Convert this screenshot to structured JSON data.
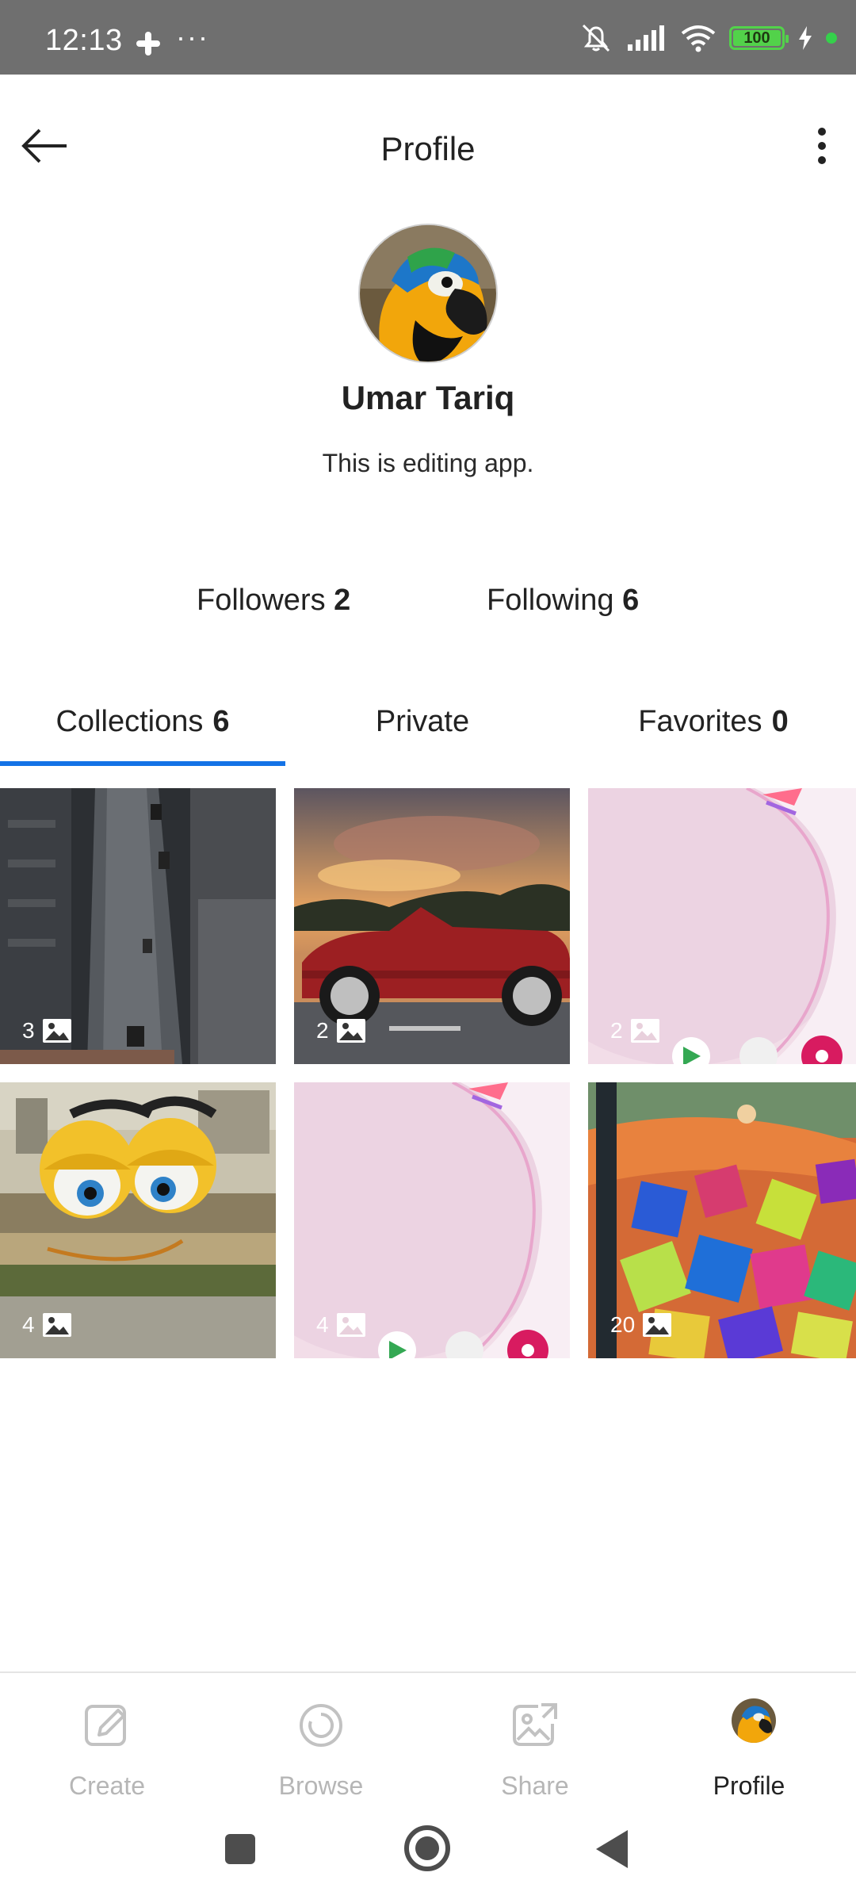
{
  "status_bar": {
    "time": "12:13",
    "dots": "···",
    "battery": "100",
    "icons": [
      "slack-icon",
      "mute-icon",
      "signal-icon",
      "wifi-icon",
      "battery-icon",
      "charging-icon"
    ]
  },
  "app_bar": {
    "title": "Profile",
    "back_icon": "arrow-left-icon",
    "menu_icon": "more-vertical-icon"
  },
  "profile": {
    "name": "Umar Tariq",
    "bio": "This is editing app.",
    "avatar": "parrot-avatar"
  },
  "stats": {
    "followers_label": "Followers",
    "followers_count": "2",
    "following_label": "Following",
    "following_count": "6"
  },
  "tabs": [
    {
      "label": "Collections",
      "count": "6",
      "active": true
    },
    {
      "label": "Private",
      "count": "",
      "active": false
    },
    {
      "label": "Favorites",
      "count": "0",
      "active": false
    }
  ],
  "collections": [
    {
      "count": "3",
      "thumb": "rainy-city-street"
    },
    {
      "count": "2",
      "thumb": "red-convertible-sunset"
    },
    {
      "count": "2",
      "thumb": "pink-wallpaper-screenshot"
    },
    {
      "count": "4",
      "thumb": "cartoon-eyes-rooftop"
    },
    {
      "count": "4",
      "thumb": "pink-wallpaper-screenshot"
    },
    {
      "count": "20",
      "thumb": "foam-pit-cubes"
    }
  ],
  "bottom_nav": [
    {
      "label": "Create",
      "icon": "pencil-icon",
      "active": false
    },
    {
      "label": "Browse",
      "icon": "browse-icon",
      "active": false
    },
    {
      "label": "Share",
      "icon": "share-icon",
      "active": false
    },
    {
      "label": "Profile",
      "icon": "avatar",
      "active": true
    }
  ],
  "colors": {
    "accent": "#1473e6",
    "status_bar": "#6f6f6f",
    "inactive_nav": "#b6b6b6"
  }
}
